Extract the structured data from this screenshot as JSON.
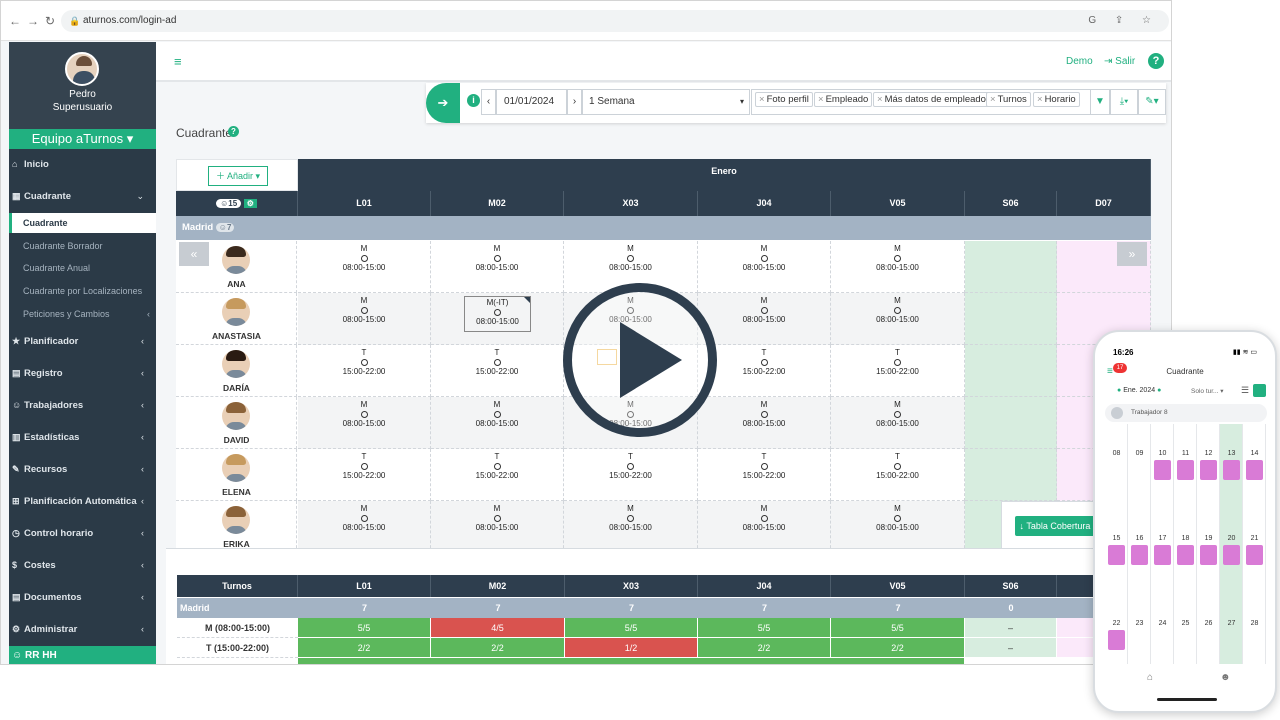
{
  "browser": {
    "url": "aturnos.com/login-ad"
  },
  "sidebar": {
    "user_name": "Pedro",
    "user_role": "Superusuario",
    "team": "Equipo aTurnos",
    "menu": [
      {
        "label": "Inicio",
        "icon": "home-icon"
      },
      {
        "label": "Cuadrante",
        "icon": "calendar-icon"
      },
      {
        "label": "Planificador",
        "icon": "star-icon"
      },
      {
        "label": "Registro",
        "icon": "file-icon"
      },
      {
        "label": "Trabajadores",
        "icon": "users-icon"
      },
      {
        "label": "Estadísticas",
        "icon": "chart-icon"
      },
      {
        "label": "Recursos",
        "icon": "wrench-icon"
      },
      {
        "label": "Planificación Automática",
        "icon": "sitemap-icon"
      },
      {
        "label": "Control horario",
        "icon": "clock-icon"
      },
      {
        "label": "Costes",
        "icon": "dollar-icon"
      },
      {
        "label": "Documentos",
        "icon": "document-icon"
      },
      {
        "label": "Administrar",
        "icon": "gear-icon"
      }
    ],
    "submenu": [
      "Cuadrante",
      "Cuadrante Borrador",
      "Cuadrante Anual",
      "Cuadrante por Localizaciones",
      "Peticiones y Cambios"
    ],
    "bottom_item": "RR HH"
  },
  "topbar": {
    "demo": "Demo",
    "salir": "Salir",
    "help": "?"
  },
  "filters": {
    "date": "01/01/2024",
    "range": "1 Semana",
    "tags": [
      "Foto perfil",
      "Empleado",
      "Más datos de empleado",
      "Turnos",
      "Horario"
    ]
  },
  "page": {
    "title": "Cuadrante"
  },
  "schedule": {
    "add_label": "Añadir",
    "employee_count": "15",
    "month": "Enero",
    "days": [
      "L01",
      "M02",
      "X03",
      "J04",
      "V05",
      "S06",
      "D07"
    ],
    "group": "Madrid",
    "group_count": "7",
    "employees": [
      {
        "name": "ANA",
        "shifts": [
          [
            "M",
            "08:00-15:00"
          ],
          [
            "M",
            "08:00-15:00"
          ],
          [
            "M",
            "08:00-15:00"
          ],
          [
            "M",
            "08:00-15:00"
          ],
          [
            "M",
            "08:00-15:00"
          ]
        ]
      },
      {
        "name": "ANASTASIA",
        "shifts": [
          [
            "M",
            "08:00-15:00"
          ],
          [
            "M(-IT)",
            "08:00-15:00"
          ],
          [
            "M",
            "08:00-15:00"
          ],
          [
            "M",
            "08:00-15:00"
          ],
          [
            "M",
            "08:00-15:00"
          ]
        ]
      },
      {
        "name": "DARÍA",
        "shifts": [
          [
            "T",
            "15:00-22:00"
          ],
          [
            "T",
            "15:00-22:00"
          ],
          [
            "",
            ""
          ],
          [
            "T",
            "15:00-22:00"
          ],
          [
            "T",
            "15:00-22:00"
          ]
        ]
      },
      {
        "name": "DAVID",
        "shifts": [
          [
            "M",
            "08:00-15:00"
          ],
          [
            "M",
            "08:00-15:00"
          ],
          [
            "M",
            "08:00-15:00"
          ],
          [
            "M",
            "08:00-15:00"
          ],
          [
            "M",
            "08:00-15:00"
          ]
        ]
      },
      {
        "name": "ELENA",
        "shifts": [
          [
            "T",
            "15:00-22:00"
          ],
          [
            "T",
            "15:00-22:00"
          ],
          [
            "T",
            "15:00-22:00"
          ],
          [
            "T",
            "15:00-22:00"
          ],
          [
            "T",
            "15:00-22:00"
          ]
        ]
      },
      {
        "name": "ERIKA",
        "shifts": [
          [
            "M",
            "08:00-15:00"
          ],
          [
            "M",
            "08:00-15:00"
          ],
          [
            "M",
            "08:00-15:00"
          ],
          [
            "M",
            "08:00-15:00"
          ],
          [
            "M",
            "08:00-15:00"
          ]
        ]
      }
    ],
    "prev_label": "«",
    "next_label": "»"
  },
  "coverage": {
    "button": "Tabla Cobertura",
    "header_first": "Turnos",
    "days": [
      "L01",
      "M02",
      "X03",
      "J04",
      "V05",
      "S06"
    ],
    "group": "Madrid",
    "group_values": [
      "7",
      "7",
      "7",
      "7",
      "7",
      "0"
    ],
    "rows": [
      {
        "label": "M (08:00-15:00)",
        "values": [
          "5/5",
          "4/5",
          "5/5",
          "5/5",
          "5/5",
          "–"
        ],
        "status": [
          "ok",
          "bad",
          "ok",
          "ok",
          "ok",
          "none"
        ]
      },
      {
        "label": "T (15:00-22:00)",
        "values": [
          "2/2",
          "2/2",
          "1/2",
          "2/2",
          "2/2",
          "–"
        ],
        "status": [
          "ok",
          "ok",
          "bad",
          "ok",
          "ok",
          "none"
        ]
      }
    ],
    "colors": {
      "ok": "#5cb85c",
      "bad": "#d9534f"
    }
  },
  "phone": {
    "time": "16:26",
    "title": "Cuadrante",
    "badge": "17",
    "month": "Ene. 2024",
    "filter": "Solo tur...",
    "worker": "Trabajador 8",
    "days_row1": [
      "08",
      "09",
      "10",
      "11",
      "12",
      "13",
      "14"
    ],
    "days_row2": [
      "15",
      "16",
      "17",
      "18",
      "19",
      "20",
      "21"
    ],
    "days_row3": [
      "22",
      "23",
      "24",
      "25",
      "26",
      "27",
      "28"
    ]
  },
  "colors": {
    "brand": "#21b080",
    "dark": "#2e3e4e",
    "sidebar": "#2b3a47"
  }
}
